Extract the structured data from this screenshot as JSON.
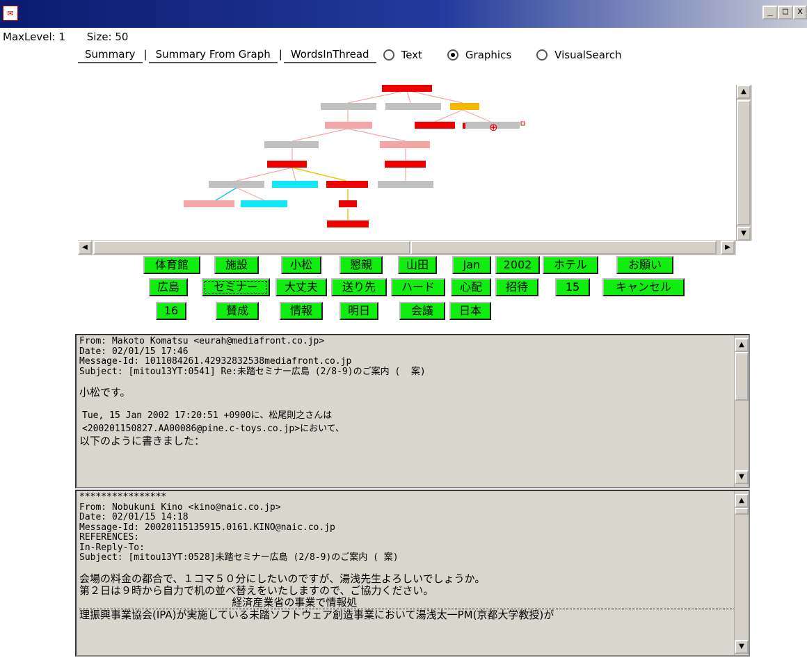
{
  "window": {
    "minimize": "_",
    "maximize": "□",
    "close": "x"
  },
  "status": {
    "max_level": "MaxLevel: 1",
    "size": "Size: 50"
  },
  "tabs": [
    "Summary",
    "Summary From Graph",
    "WordsInThread"
  ],
  "tab_separator": "|",
  "radio_options": [
    {
      "label": "Text",
      "selected": false
    },
    {
      "label": "Graphics",
      "selected": true
    },
    {
      "label": "VisualSearch",
      "selected": false
    }
  ],
  "thread_graph": {
    "colors": {
      "red": "#ee0000",
      "gray": "#c0c0c0",
      "pink": "#f4a6a6",
      "orange": "#f5b800",
      "cyan": "#10e8f8"
    }
  },
  "keywords": [
    [
      "体育館",
      "施設",
      "小松",
      "懇親",
      "山田",
      "Jan",
      "2002",
      "ホテル",
      "お願い"
    ],
    [
      "広島",
      "セミナー",
      "大丈夫",
      "送り先",
      "ハード",
      "心配",
      "招待",
      "15",
      "キャンセル"
    ],
    [
      "16",
      "賛成",
      "情報",
      "明日",
      "会議",
      "日本"
    ]
  ],
  "keyword_color": "#10ee10",
  "messages": [
    {
      "headers": [
        "From: Makoto Komatsu <eurah@mediafront.co.jp>",
        "Date: 02/01/15 17:46",
        "Message-Id: 1011084261.42932832538mediafront.co.jp",
        "Subject: [mitou13YT:0541] Re:未踏セミナー広島 (2/8-9)のご案内 (  案)"
      ],
      "body": [
        "",
        "小松です。",
        "",
        "Tue, 15 Jan 2002 17:20:51 +0900に、松尾則之さんは",
        "<200201150827.AA00086@pine.c-toys.co.jp>において、",
        "以下のように書きました："
      ]
    },
    {
      "headers": [
        "****************",
        "From: Nobukuni Kino <kino@naic.co.jp>",
        "Date: 02/01/15 14:18",
        "Message-Id: 20020115135915.0161.KINO@naic.co.jp",
        "REFERENCES:",
        "In-Reply-To:",
        "Subject: [mitou13YT:0528]未踏セミナー広島 (2/8-9)のご案内 ( 案)"
      ],
      "body": [
        "",
        "会場の料金の都合で、１コマ５０分にしたいのですが、湯浅先生よろしいでしょうか。",
        "第２日は９時から自力で机の並べ替えをいたしますので、ご協力ください。",
        "                                              経済産業省の事業で情報処",
        "理振興事業協会(IPA)が実施している未踏ソフトウェア創造事業において湯浅太一PM(京都大学教授)が"
      ]
    }
  ]
}
